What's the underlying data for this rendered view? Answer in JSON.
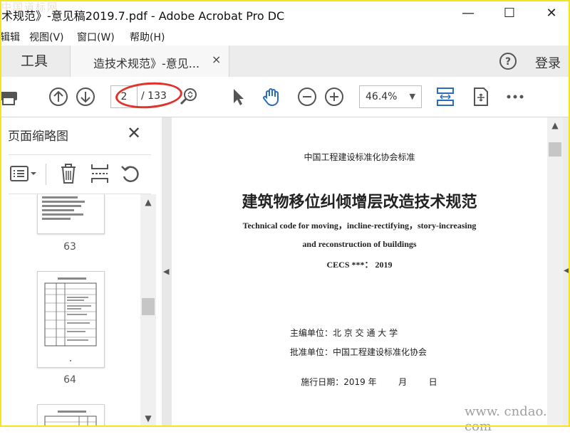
{
  "watermark_top": "中国道标网",
  "window": {
    "title": "术规范》-意见稿2019.7.pdf - Adobe Acrobat Pro DC",
    "controls": {
      "minimize": "—",
      "maximize": "☐",
      "close": "✕"
    }
  },
  "menu": [
    "辑辑",
    "视图(V)",
    "窗口(W)",
    "帮助(H)"
  ],
  "tabs": {
    "tools": "工具",
    "document": "造技术规范》-意见...",
    "close_symbol": "×",
    "login": "登录"
  },
  "toolbar": {
    "current_page": "2",
    "total_pages": "/ 133",
    "zoom": "46.4%"
  },
  "sidebar": {
    "title": "页面缩略图",
    "close_symbol": "✕",
    "thumbnails": [
      {
        "number": "63"
      },
      {
        "number": "64"
      }
    ]
  },
  "document": {
    "org": "中国工程建设标准化协会标准",
    "title_cn": "建筑物移位纠倾增层改造技术规范",
    "title_en_1": "Technical code for moving，incline-rectifying，story-increasing",
    "title_en_2": "and reconstruction of buildings",
    "code": "CECS ***：  2019",
    "editor_label": "主编单位：",
    "editor_value": "北  京  交  通  大  学",
    "approver_label": "批准单位：",
    "approver_value": "中国工程建设标准化协会",
    "date_label": "施行日期：",
    "date_value": "2019 年        月        日"
  },
  "watermark_br": "www. cndao. com",
  "colors": {
    "accent_blue": "#2a6dbf",
    "annotation_red": "#e0332b",
    "frame_yellow": "#f4e61b"
  }
}
